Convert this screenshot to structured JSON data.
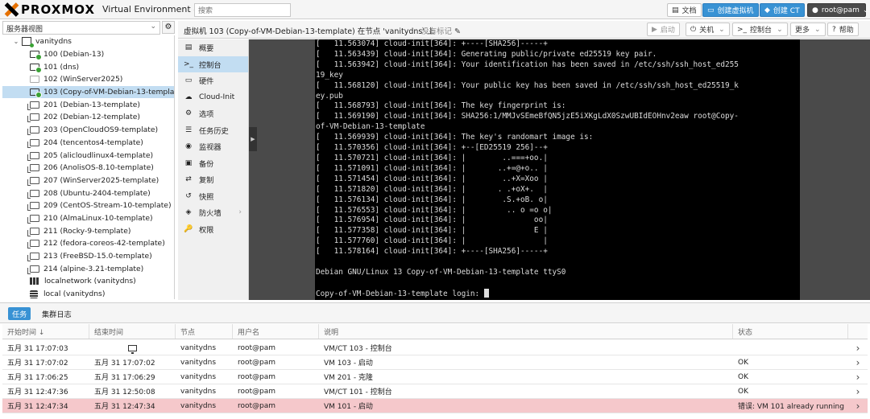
{
  "topbar": {
    "brand": "PROXMOX",
    "version": "Virtual Environment 8.4.1",
    "search_placeholder": "搜索",
    "docs": "文档",
    "create_vm": "创建虚拟机",
    "create_ct": "创建 CT",
    "user": "root@pam"
  },
  "tree": {
    "view_label": "服务器视图",
    "root": "vanitydns",
    "items": [
      {
        "label": "100 (Debian-13)",
        "kind": "run"
      },
      {
        "label": "101 (dns)",
        "kind": "run"
      },
      {
        "label": "102 (WinServer2025)",
        "kind": "off"
      },
      {
        "label": "103 (Copy-of-VM-Debian-13-template)",
        "kind": "run"
      },
      {
        "label": "201 (Debian-13-template)",
        "kind": "tpl"
      },
      {
        "label": "202 (Debian-12-template)",
        "kind": "tpl"
      },
      {
        "label": "203 (OpenCloudOS9-template)",
        "kind": "tpl"
      },
      {
        "label": "204 (tencentos4-template)",
        "kind": "tpl"
      },
      {
        "label": "205 (alicloudlinux4-template)",
        "kind": "tpl"
      },
      {
        "label": "206 (AnolisOS-8.10-template)",
        "kind": "tpl"
      },
      {
        "label": "207 (WinServer2025-template)",
        "kind": "tpl"
      },
      {
        "label": "208 (Ubuntu-2404-template)",
        "kind": "tpl"
      },
      {
        "label": "209 (CentOS-Stream-10-template)",
        "kind": "tpl"
      },
      {
        "label": "210 (AlmaLinux-10-template)",
        "kind": "tpl"
      },
      {
        "label": "211 (Rocky-9-template)",
        "kind": "tpl"
      },
      {
        "label": "212 (fedora-coreos-42-template)",
        "kind": "tpl"
      },
      {
        "label": "213 (FreeBSD-15.0-template)",
        "kind": "tpl"
      },
      {
        "label": "214 (alpine-3.21-template)",
        "kind": "tpl"
      }
    ],
    "network": "localnetwork (vanitydns)",
    "storage": "local (vanitydns)"
  },
  "content_header": {
    "title": "虚拟机 103 (Copy-of-VM-Debian-13-template) 在节点 'vanitydns' 上",
    "no_tags": "没有标记",
    "start": "启动",
    "shutdown": "关机",
    "console": "控制台",
    "more": "更多",
    "help": "帮助"
  },
  "nav": [
    {
      "label": "概要",
      "icon": "▤"
    },
    {
      "label": "控制台",
      "icon": ">_"
    },
    {
      "label": "硬件",
      "icon": "▭"
    },
    {
      "label": "Cloud-Init",
      "icon": "☁"
    },
    {
      "label": "选项",
      "icon": "⚙"
    },
    {
      "label": "任务历史",
      "icon": "☰"
    },
    {
      "label": "监视器",
      "icon": "◉"
    },
    {
      "label": "备份",
      "icon": "▣"
    },
    {
      "label": "复制",
      "icon": "⇄"
    },
    {
      "label": "快照",
      "icon": "↺"
    },
    {
      "label": "防火墙",
      "icon": "◈"
    },
    {
      "label": "权限",
      "icon": "🔑"
    }
  ],
  "console_lines": [
    "[   11.563074] cloud-init[364]: +----[SHA256]-----+",
    "[   11.563439] cloud-init[364]: Generating public/private ed25519 key pair.",
    "[   11.563942] cloud-init[364]: Your identification has been saved in /etc/ssh/ssh_host_ed255",
    "19_key",
    "[   11.568120] cloud-init[364]: Your public key has been saved in /etc/ssh/ssh_host_ed25519_k",
    "ey.pub",
    "[   11.568793] cloud-init[364]: The key fingerprint is:",
    "[   11.569190] cloud-init[364]: SHA256:1/MMJvSEmeBfQN5jzE5iXKgLdX0SzwUBIdEOHnv2eaw root@Copy-",
    "of-VM-Debian-13-template",
    "[   11.569939] cloud-init[364]: The key's randomart image is:",
    "[   11.570356] cloud-init[364]: +--[ED25519 256]--+",
    "[   11.570721] cloud-init[364]: |        ..===+oo.|",
    "[   11.571091] cloud-init[364]: |       ..+=@+o.. |",
    "[   11.571454] cloud-init[364]: |        ..+X=Xoo |",
    "[   11.571820] cloud-init[364]: |       . .+oX+.  |",
    "[   11.576134] cloud-init[364]: |        .S.+oB. o|",
    "[   11.576553] cloud-init[364]: |         .. o =o o|",
    "[   11.576954] cloud-init[364]: |               oo|",
    "[   11.577358] cloud-init[364]: |               E |",
    "[   11.577760] cloud-init[364]: |                 |",
    "[   11.578164] cloud-init[364]: +----[SHA256]-----+",
    "",
    "Debian GNU/Linux 13 Copy-of-VM-Debian-13-template ttyS0",
    "",
    "Copy-of-VM-Debian-13-template login: "
  ],
  "bottom": {
    "tab_tasks": "任务",
    "tab_cluster_log": "集群日志",
    "columns": {
      "start": "开始时间 ↓",
      "end": "结束时间",
      "node": "节点",
      "user": "用户名",
      "desc": "说明",
      "status": "状态"
    },
    "rows": [
      {
        "start": "五月 31 17:07:03",
        "end": "",
        "node": "vanitydns",
        "user": "root@pam",
        "desc": "VM/CT 103 - 控制台",
        "status": "",
        "running": true,
        "error": false
      },
      {
        "start": "五月 31 17:07:02",
        "end": "五月 31 17:07:02",
        "node": "vanitydns",
        "user": "root@pam",
        "desc": "VM 103 - 启动",
        "status": "OK",
        "running": false,
        "error": false
      },
      {
        "start": "五月 31 17:06:25",
        "end": "五月 31 17:06:29",
        "node": "vanitydns",
        "user": "root@pam",
        "desc": "VM 201 - 克隆",
        "status": "OK",
        "running": false,
        "error": false
      },
      {
        "start": "五月 31 12:47:36",
        "end": "五月 31 12:50:08",
        "node": "vanitydns",
        "user": "root@pam",
        "desc": "VM/CT 101 - 控制台",
        "status": "OK",
        "running": false,
        "error": false
      },
      {
        "start": "五月 31 12:47:34",
        "end": "五月 31 12:47:34",
        "node": "vanitydns",
        "user": "root@pam",
        "desc": "VM 101 - 启动",
        "status": "错误: VM 101 already running",
        "running": false,
        "error": true
      }
    ]
  }
}
